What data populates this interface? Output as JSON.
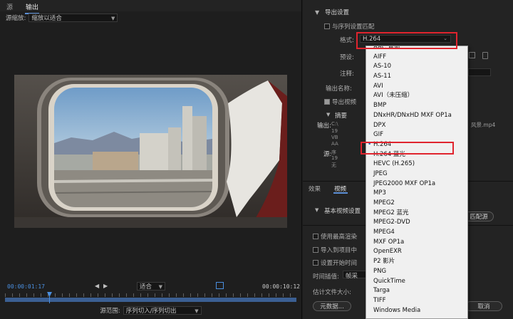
{
  "left": {
    "tabs": [
      "源",
      "输出"
    ],
    "source_scaling_label": "源缩放:",
    "source_scaling_value": "缩放以适合",
    "timecode_start": "00:00:01:17",
    "timecode_end": "00:00:10:12",
    "fit_value": "适合",
    "source_range_label": "源范围:",
    "source_range_value": "序列切入/序列切出"
  },
  "right": {
    "section_title": "导出设置",
    "match_sequence": "与序列设置匹配",
    "format_label": "格式:",
    "format_value": "H.264",
    "preset_label": "预设:",
    "comment_label": "注释:",
    "output_name_label": "输出名称:",
    "export_video": "导出视频",
    "summary": "摘要",
    "output_label": "输出:",
    "output_partial": [
      "C:\\",
      "19",
      "VB",
      "AA"
    ],
    "output_suffix": "风景.mp4",
    "source_label": "源:",
    "source_partial": [
      "序",
      "19",
      "无"
    ],
    "tabs": [
      "效果",
      "视频"
    ],
    "basic_video_settings": "基本视频设置",
    "match_source_button": "匹配源",
    "use_max_render": "使用最高渲染",
    "import_into_project": "导入到项目中",
    "set_start_timecode": "设置开始时间",
    "time_interpolation_label": "时间插值:",
    "time_interpolation_value": "帧采",
    "estimated_size_label": "估计文件大小:",
    "metadata_button": "元数据...",
    "cancel_button": "取消"
  },
  "format_list": {
    "selected": "H.264",
    "items": [
      "AAC 音频",
      "AIFF",
      "AS-10",
      "AS-11",
      "AVI",
      "AVI（未压缩）",
      "BMP",
      "DNxHR/DNxHD MXF OP1a",
      "DPX",
      "GIF",
      "H.264",
      "H.264 蓝光",
      "HEVC (H.265)",
      "JPEG",
      "JPEG2000 MXF OP1a",
      "MP3",
      "MPEG2",
      "MPEG2 蓝光",
      "MPEG2-DVD",
      "MPEG4",
      "MXF OP1a",
      "OpenEXR",
      "P2 影片",
      "PNG",
      "QuickTime",
      "Targa",
      "TIFF",
      "Windows Media"
    ]
  },
  "colors": {
    "highlight": "#e0242e",
    "accent": "#5c8fd6",
    "timecode": "#4a8fe0"
  }
}
